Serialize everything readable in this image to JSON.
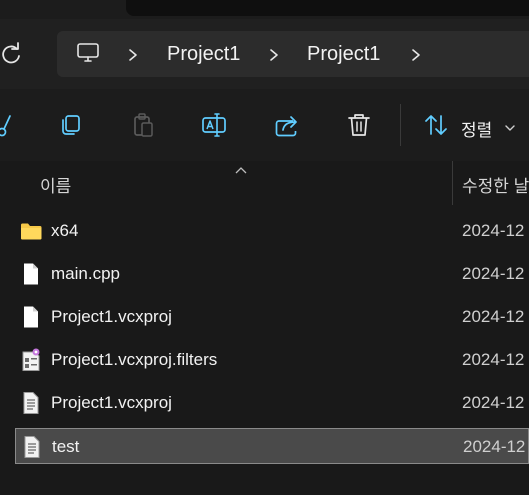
{
  "breadcrumb": {
    "items": [
      {
        "label": "Project1"
      },
      {
        "label": "Project1"
      }
    ]
  },
  "toolbar": {
    "sort_label": "정렬"
  },
  "columns": {
    "name": "이름",
    "date_modified": "수정한 날"
  },
  "files": [
    {
      "name": "x64",
      "date": "2024-12",
      "icon": "folder-icon",
      "selected": false
    },
    {
      "name": "main.cpp",
      "date": "2024-12",
      "icon": "file-icon",
      "selected": false
    },
    {
      "name": "Project1.vcxproj",
      "date": "2024-12",
      "icon": "file-icon",
      "selected": false
    },
    {
      "name": "Project1.vcxproj.filters",
      "date": "2024-12",
      "icon": "filters-file-icon",
      "selected": false
    },
    {
      "name": "Project1.vcxproj",
      "date": "2024-12",
      "icon": "text-file-icon",
      "selected": false
    },
    {
      "name": "test",
      "date": "2024-12",
      "icon": "text-file-icon",
      "selected": true
    }
  ],
  "colors": {
    "accent": "#60cdff",
    "folder": "#f7c948",
    "selection": "#4a4a4a"
  }
}
